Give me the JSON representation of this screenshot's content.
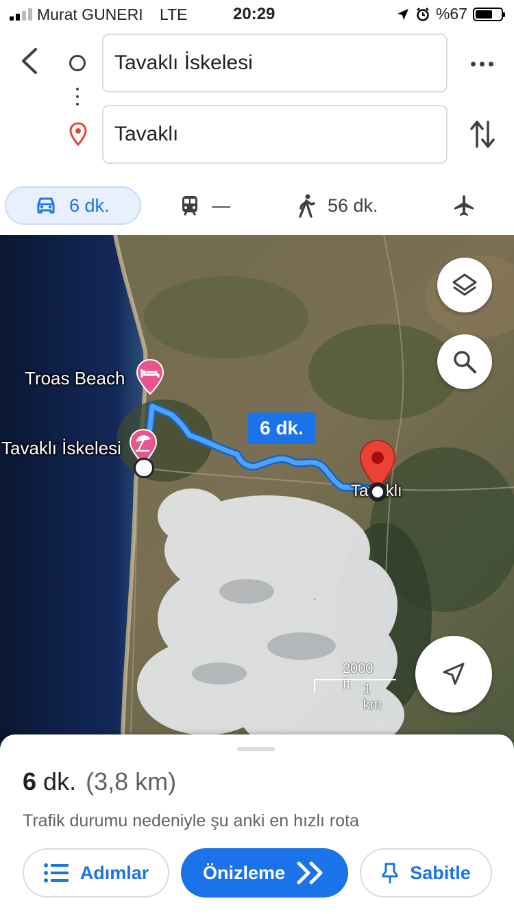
{
  "status_bar": {
    "carrier": "Murat GUNERI",
    "network": "LTE",
    "time": "20:29",
    "battery": "%67",
    "battery_level": 0.67
  },
  "search": {
    "origin": "Tavaklı İskelesi",
    "destination": "Tavaklı"
  },
  "modes": {
    "car": "6 dk.",
    "transit": "—",
    "walk": "56 dk."
  },
  "map": {
    "labels": {
      "troas": "Troas Beach",
      "origin": "Tavaklı İskelesi",
      "destination": "Tavaklı"
    },
    "route_badge": "6 dk.",
    "scale_imperial": "2000 ft",
    "scale_metric": "1 km"
  },
  "sheet": {
    "duration_number": "6",
    "duration_unit": "dk.",
    "distance": "(3,8 km)",
    "note": "Trafik durumu nedeniyle şu anki en hızlı rota",
    "steps_label": "Adımlar",
    "preview_label": "Önizleme",
    "pin_label": "Sabitle"
  },
  "colors": {
    "accent": "#1a73e8",
    "pin_red": "#ea4335",
    "poi_pink": "#e8548b",
    "route": "#4fa3ff"
  }
}
